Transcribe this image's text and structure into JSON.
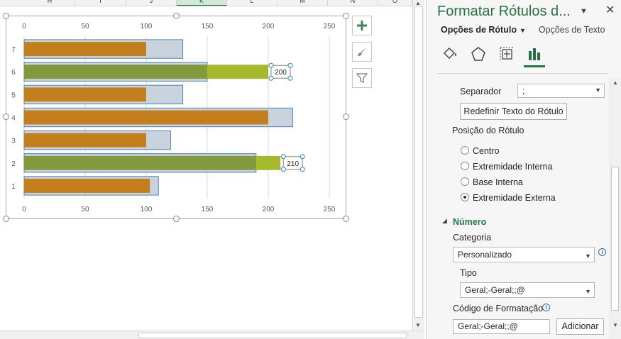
{
  "sheet": {
    "columns": [
      "H",
      "I",
      "J",
      "K",
      "L",
      "M",
      "N",
      "O"
    ],
    "selected_column": "K"
  },
  "chart_data": {
    "type": "bar",
    "orientation": "horizontal",
    "categories": [
      "1",
      "2",
      "3",
      "4",
      "5",
      "6",
      "7"
    ],
    "x_ticks": [
      "0",
      "50",
      "100",
      "150",
      "200",
      "250"
    ],
    "xlim": [
      0,
      250
    ],
    "series": [
      {
        "values": [
          110,
          190,
          120,
          220,
          130,
          150,
          130
        ],
        "color": "#c8d3de"
      },
      {
        "values": [
          103,
          210,
          100,
          200,
          100,
          200,
          100
        ],
        "color": "#c37f1b"
      }
    ],
    "highlight_categories": [
      "2",
      "6"
    ],
    "highlight_colors": {
      "inside": "#84993c",
      "outside": "#a6b82b"
    },
    "data_labels": [
      {
        "category": "6",
        "text": "200"
      },
      {
        "category": "2",
        "text": "210"
      }
    ],
    "axis_top": true,
    "axis_bottom": true,
    "grid": true
  },
  "chart_tools": [
    {
      "name": "chart-elements-button",
      "icon": "plus-icon"
    },
    {
      "name": "chart-styles-button",
      "icon": "brush-icon"
    },
    {
      "name": "chart-filters-button",
      "icon": "filter-icon"
    }
  ],
  "pane": {
    "title": "Formatar Rótulos d...",
    "tab_label_options": "Opções de Rótulo",
    "tab_text_options": "Opções de Texto",
    "icons": [
      "fill-line-icon",
      "effects-icon",
      "size-properties-icon",
      "label-options-icon"
    ],
    "separator_label": "Separador",
    "separator_value": ";",
    "reset_button": "Redefinir Texto do Rótulo",
    "position_label": "Posição do Rótulo",
    "position_options": [
      "Centro",
      "Extremidade Interna",
      "Base Interna",
      "Extremidade Externa"
    ],
    "position_selected": 3,
    "number_section": "Número",
    "category_label": "Categoria",
    "category_value": "Personalizado",
    "type_label": "Tipo",
    "type_value": "Geral;-Geral;;@",
    "format_code_label": "Código de Formatação",
    "format_code_value": "Geral;-Geral;;@",
    "add_button": "Adicionar"
  }
}
